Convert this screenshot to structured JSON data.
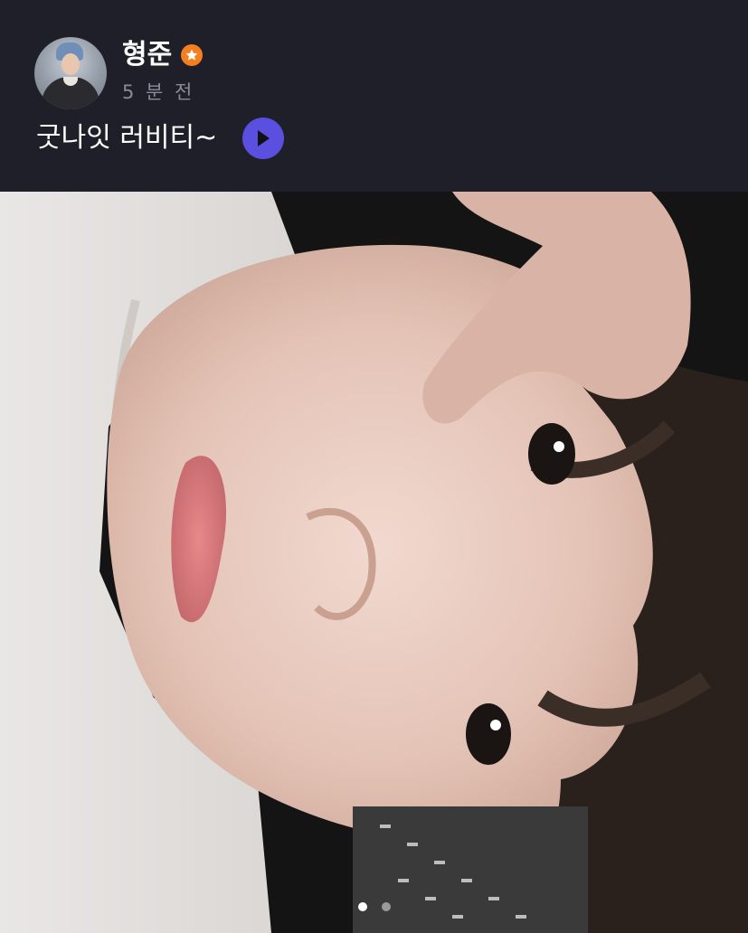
{
  "post": {
    "author_name": "형준",
    "timestamp": "5 분 전",
    "caption": "굿나잇 러비티~",
    "badge_icon": "star-icon",
    "badge_color": "#f57e1f",
    "play_icon": "play-icon",
    "play_color": "#5b4fe0",
    "image_count": 2,
    "current_image": 1
  }
}
